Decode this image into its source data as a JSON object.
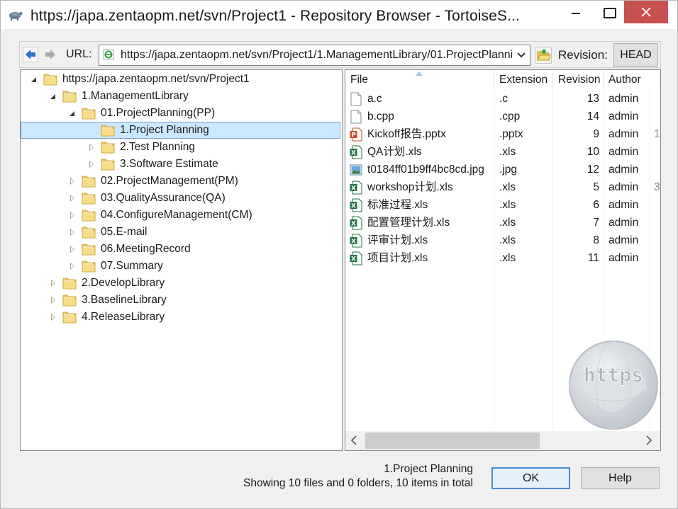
{
  "window": {
    "title": "https://japa.zentaopm.net/svn/Project1 - Repository Browser - TortoiseS..."
  },
  "toolbar": {
    "back_icon": "arrow-left-icon",
    "forward_icon": "arrow-right-icon",
    "url_label": "URL:",
    "url_value": "https://japa.zentaopm.net/svn/Project1/1.ManagementLibrary/01.ProjectPlanni",
    "revision_label": "Revision:",
    "revision_value": "HEAD"
  },
  "tree": [
    {
      "label": "https://japa.zentaopm.net/svn/Project1",
      "level": 0,
      "expander": "open",
      "selected": false
    },
    {
      "label": "1.ManagementLibrary",
      "level": 1,
      "expander": "open",
      "selected": false
    },
    {
      "label": "01.ProjectPlanning(PP)",
      "level": 2,
      "expander": "open",
      "selected": false
    },
    {
      "label": "1.Project Planning",
      "level": 3,
      "expander": "none",
      "selected": true
    },
    {
      "label": "2.Test Planning",
      "level": 3,
      "expander": "closed",
      "selected": false
    },
    {
      "label": "3.Software Estimate",
      "level": 3,
      "expander": "closed",
      "selected": false
    },
    {
      "label": "02.ProjectManagement(PM)",
      "level": 2,
      "expander": "closed",
      "selected": false
    },
    {
      "label": "03.QualityAssurance(QA)",
      "level": 2,
      "expander": "closed",
      "selected": false
    },
    {
      "label": "04.ConfigureManagement(CM)",
      "level": 2,
      "expander": "closed",
      "selected": false
    },
    {
      "label": "05.E-mail",
      "level": 2,
      "expander": "closed",
      "selected": false
    },
    {
      "label": "06.MeetingRecord",
      "level": 2,
      "expander": "closed",
      "selected": false
    },
    {
      "label": "07.Summary",
      "level": 2,
      "expander": "closed",
      "selected": false
    },
    {
      "label": "2.DevelopLibrary",
      "level": 1,
      "expander": "closed",
      "selected": false
    },
    {
      "label": "3.BaselineLibrary",
      "level": 1,
      "expander": "closed",
      "selected": false
    },
    {
      "label": "4.ReleaseLibrary",
      "level": 1,
      "expander": "closed",
      "selected": false
    }
  ],
  "file_list": {
    "columns": {
      "file": "File",
      "extension": "Extension",
      "revision": "Revision",
      "author": "Author"
    },
    "rows": [
      {
        "name": "a.c",
        "ext": ".c",
        "rev": "13",
        "author": "admin",
        "extra": "",
        "icon": "text-file-icon"
      },
      {
        "name": "b.cpp",
        "ext": ".cpp",
        "rev": "14",
        "author": "admin",
        "extra": "",
        "icon": "text-file-icon"
      },
      {
        "name": "Kickoff报告.pptx",
        "ext": ".pptx",
        "rev": "9",
        "author": "admin",
        "extra": "1",
        "icon": "powerpoint-file-icon"
      },
      {
        "name": "QA计划.xls",
        "ext": ".xls",
        "rev": "10",
        "author": "admin",
        "extra": "",
        "icon": "excel-file-icon"
      },
      {
        "name": "t0184ff01b9ff4bc8cd.jpg",
        "ext": ".jpg",
        "rev": "12",
        "author": "admin",
        "extra": "",
        "icon": "image-file-icon"
      },
      {
        "name": "workshop计划.xls",
        "ext": ".xls",
        "rev": "5",
        "author": "admin",
        "extra": "3",
        "icon": "excel-file-icon"
      },
      {
        "name": "标准过程.xls",
        "ext": ".xls",
        "rev": "6",
        "author": "admin",
        "extra": "",
        "icon": "excel-file-icon"
      },
      {
        "name": "配置管理计划.xls",
        "ext": ".xls",
        "rev": "7",
        "author": "admin",
        "extra": "",
        "icon": "excel-file-icon"
      },
      {
        "name": "评审计划.xls",
        "ext": ".xls",
        "rev": "8",
        "author": "admin",
        "extra": "",
        "icon": "excel-file-icon"
      },
      {
        "name": "项目计划.xls",
        "ext": ".xls",
        "rev": "11",
        "author": "admin",
        "extra": "",
        "icon": "excel-file-icon"
      }
    ]
  },
  "watermark": "https",
  "status": {
    "current_path": "1.Project Planning",
    "summary": "Showing 10 files and 0 folders, 10 items in total"
  },
  "buttons": {
    "ok": "OK",
    "help": "Help"
  }
}
